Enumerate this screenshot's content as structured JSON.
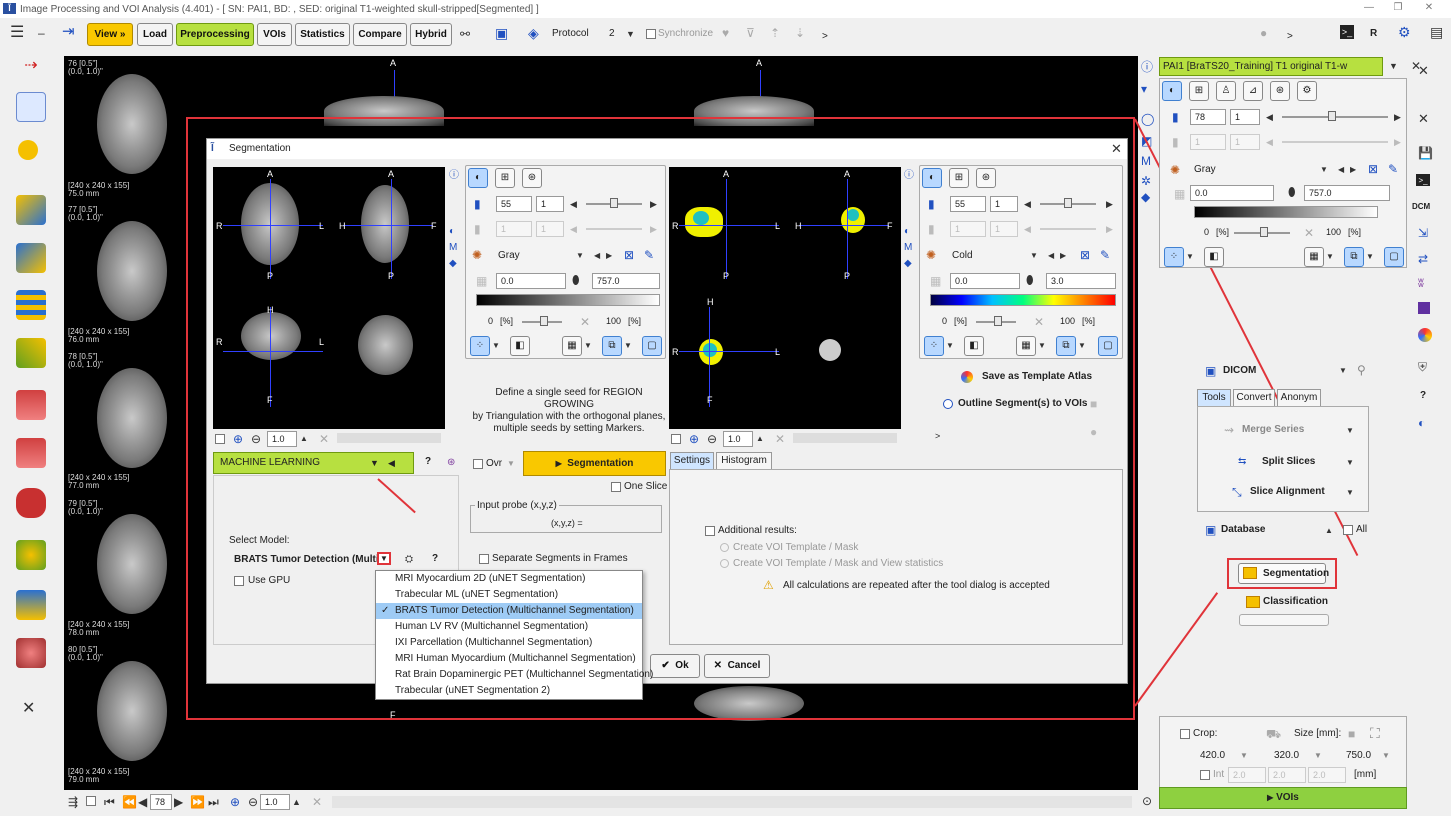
{
  "window": {
    "title": "Image Processing and VOI Analysis (4.401) - [ SN: PAI1, BD: , SED: original T1-weighted skull-stripped[Segmented] ]"
  },
  "toolbar": {
    "view": "View »",
    "load": "Load",
    "preprocessing": "Preprocessing",
    "vois": "VOIs",
    "statistics": "Statistics",
    "compare": "Compare",
    "hybrid": "Hybrid",
    "protocol": "Protocol",
    "layout_count": "2",
    "synchronize": "Synchronize",
    "more": ">",
    "r_label": "R"
  },
  "slices": [
    {
      "idx": "76 [0.5\"]\n(0.0, 1.0)\"",
      "dim": "[240 x 240 x 155]\n75.0 mm"
    },
    {
      "idx": "77 [0.5\"]\n(0.0, 1.0)\"",
      "dim": "[240 x 240 x 155]\n76.0 mm"
    },
    {
      "idx": "78 [0.5\"]\n(0.0, 1.0)\"",
      "dim": "[240 x 240 x 155]\n77.0 mm"
    },
    {
      "idx": "79 [0.5\"]\n(0.0, 1.0)\"",
      "dim": "[240 x 240 x 155]\n78.0 mm"
    },
    {
      "idx": "80 [0.5\"]\n(0.0, 1.0)\"",
      "dim": "[240 x 240 x 155]\n79.0 mm"
    }
  ],
  "bottom": {
    "frame": "78",
    "zoom": "1.0"
  },
  "orient": {
    "a": "A",
    "f": "F"
  },
  "dialog": {
    "title": "Segmentation",
    "ortho": {
      "a": "A",
      "p": "P",
      "r": "R",
      "l": "L",
      "h": "H",
      "f": "F"
    },
    "left_panel": {
      "slice": "55",
      "step": "1",
      "v2": "1",
      "v3": "1",
      "lut": "Gray",
      "min": "0.0",
      "max": "757.0",
      "pct_lo": "0",
      "pct_hi": "100",
      "pct_unit": "[%]"
    },
    "right_panel": {
      "slice": "55",
      "step": "1",
      "v2": "1",
      "v3": "1",
      "lut": "Cold",
      "min": "0.0",
      "max": "3.0",
      "pct_lo": "0",
      "pct_hi": "100",
      "pct_unit": "[%]"
    },
    "seed_help": "Define a single seed for REGION GROWING\nby Triangulation with the orthogonal planes,\nmultiple seeds by setting Markers.",
    "zoom_left": "1.0",
    "zoom_right": "1.0",
    "save_atlas": "Save as Template Atlas",
    "outline": "Outline Segment(s) to VOIs",
    "method": "MACHINE LEARNING",
    "help": "?",
    "ovr": "Ovr",
    "segmentation_btn": "Segmentation",
    "one_slice": "One Slice",
    "input_probe": "Input probe (x,y,z)",
    "xyz": "(x,y,z) =",
    "separate": "Separate Segments in Frames",
    "select_model": "Select Model:",
    "model": "BRATS Tumor Detection (Multich",
    "use_gpu": "Use GPU",
    "tabs": [
      "Settings",
      "Histogram"
    ],
    "additional": "Additional results:",
    "opt1": "Create VOI Template / Mask",
    "opt2": "Create VOI Template / Mask and View statistics",
    "warning": "All calculations are repeated after the tool dialog is accepted",
    "ok": "Ok",
    "cancel": "Cancel",
    "more": ">"
  },
  "dropdown": {
    "items": [
      "MRI Myocardium 2D (uNET Segmentation)",
      "Trabecular ML (uNET Segmentation)",
      "BRATS Tumor Detection (Multichannel Segmentation)",
      "Human LV RV (Multichannel Segmentation)",
      "IXI Parcellation (Multichannel Segmentation)",
      "MRI Human Myocardium (Multichannel Segmentation)",
      "Rat Brain Dopaminergic PET (Multichannel Segmentation)",
      "Trabecular (uNET Segmentation 2)"
    ],
    "check": "✓"
  },
  "right": {
    "series": "PAI1 [BraTS20_Training] T1 original T1-w",
    "slice": "78",
    "step": "1",
    "v2": "1",
    "v3": "1",
    "lut": "Gray",
    "min": "0.0",
    "max": "757.0",
    "pct_lo": "0",
    "pct_hi": "100",
    "pct_unit": "[%]",
    "dicom": "DICOM",
    "tabs": [
      "Tools",
      "Convert",
      "Anonym"
    ],
    "merge": "Merge Series",
    "split": "Split Slices",
    "align": "Slice Alignment",
    "database": "Database",
    "all": "All",
    "segmentation": "Segmentation",
    "classification": "Classification",
    "crop": "Crop:",
    "size": "Size [mm]:",
    "s1": "420.0",
    "s2": "320.0",
    "s3": "750.0",
    "int": "Int",
    "i1": "2.0",
    "i2": "2.0",
    "i3": "2.0",
    "unit": "[mm]",
    "vois": "VOIs",
    "more": ">"
  },
  "sidebar_right": {
    "dcm": "DCM",
    "q": "?"
  }
}
